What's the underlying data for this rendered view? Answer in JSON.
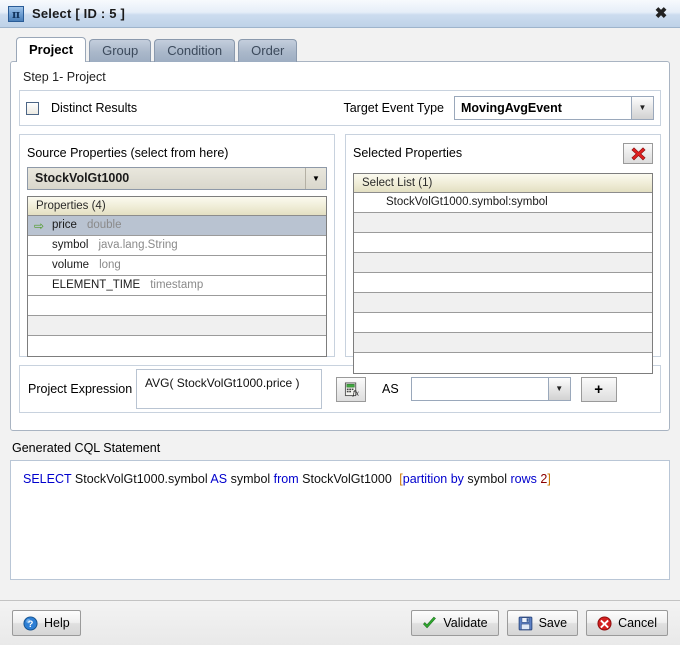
{
  "window": {
    "title": "Select [ ID : 5 ]",
    "icon": "pi-icon",
    "icon_glyph": "π",
    "close_label": "✖"
  },
  "tabs": [
    {
      "label": "Project",
      "active": true
    },
    {
      "label": "Group",
      "active": false
    },
    {
      "label": "Condition",
      "active": false
    },
    {
      "label": "Order",
      "active": false
    }
  ],
  "step": {
    "label": "Step 1- Project"
  },
  "options": {
    "distinct_label": "Distinct Results",
    "distinct_checked": false,
    "target_event_type_label": "Target Event Type",
    "target_event_type_value": "MovingAvgEvent",
    "dropdown_arrow": "▼"
  },
  "source_panel": {
    "title": "Source Properties (select from here)",
    "stream_value": "StockVolGt1000",
    "grid_header": "Properties (4)",
    "selected_arrow": "⇨",
    "rows": [
      {
        "name": "price",
        "type": "double",
        "selected": true
      },
      {
        "name": "symbol",
        "type": "java.lang.String",
        "selected": false
      },
      {
        "name": "volume",
        "type": "long",
        "selected": false
      },
      {
        "name": "ELEMENT_TIME",
        "type": "timestamp",
        "selected": false
      }
    ],
    "empty_rows": 3
  },
  "selected_panel": {
    "title": "Selected Properties",
    "delete_icon": "red-x-icon",
    "grid_header": "Select List (1)",
    "items": [
      "StockVolGt1000.symbol:symbol"
    ],
    "empty_rows": 8
  },
  "expression": {
    "label": "Project Expression",
    "value": "AVG( StockVolGt1000.price )",
    "builder_icon": "calculator-fx-icon",
    "as_label": "AS",
    "as_value": "",
    "as_placeholder": "",
    "add_label": "+"
  },
  "cql": {
    "label": "Generated CQL Statement",
    "tokens": [
      {
        "t": "SELECT",
        "c": "kw"
      },
      {
        "t": "StockVolGt1000.symbol",
        "c": "idn"
      },
      {
        "t": "AS",
        "c": "kw"
      },
      {
        "t": "symbol",
        "c": "idn"
      },
      {
        "t": "from",
        "c": "kw"
      },
      {
        "t": "StockVolGt1000",
        "c": "idn"
      },
      {
        "t": "[",
        "c": "brk"
      },
      {
        "t": "partition by",
        "c": "kw"
      },
      {
        "t": "symbol",
        "c": "idn"
      },
      {
        "t": "rows",
        "c": "kw"
      },
      {
        "t": "2",
        "c": "num"
      },
      {
        "t": "]",
        "c": "brk"
      }
    ],
    "full_text": "SELECT StockVolGt1000.symbol AS symbol from  StockVolGt1000  [partition by  symbol  rows 2 ]"
  },
  "footer": {
    "help": "Help",
    "validate": "Validate",
    "save": "Save",
    "cancel": "Cancel"
  },
  "colors": {
    "accent_blue": "#0000cd",
    "bracket_orange": "#cc7700",
    "number_red": "#8b0000",
    "selection_gray": "#b9c3d1",
    "grid_header_cream": "#eeebd4"
  }
}
